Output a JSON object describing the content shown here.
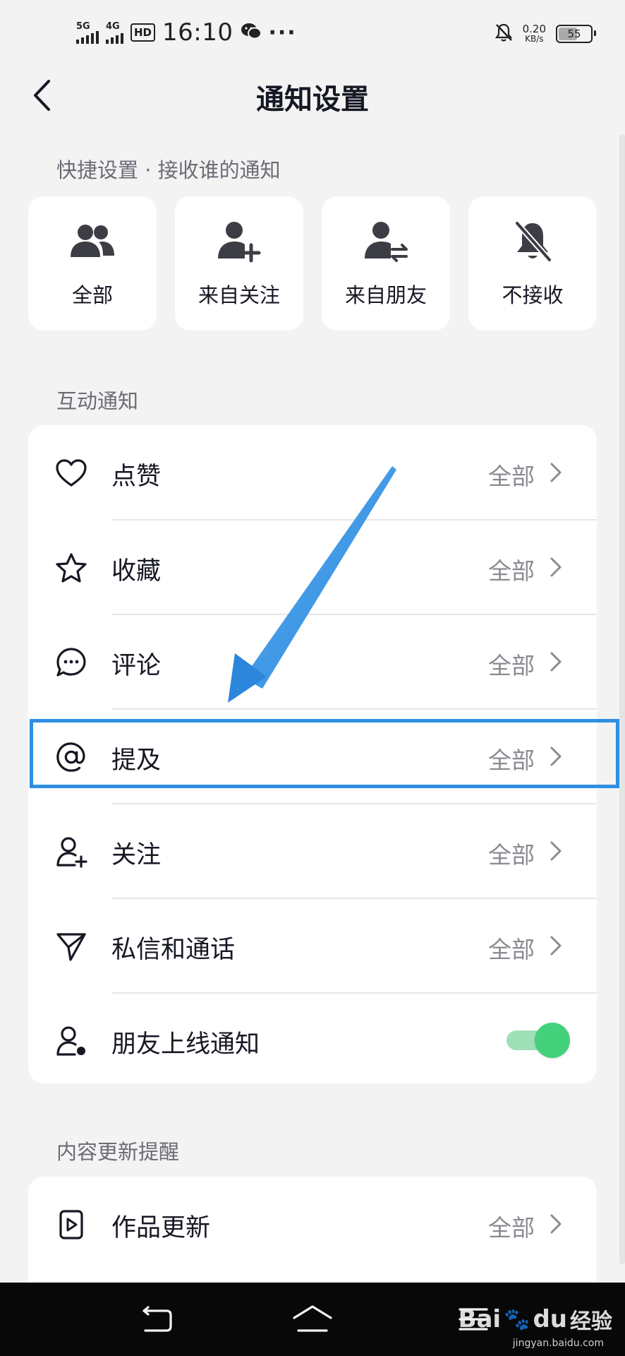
{
  "status_bar": {
    "signal_1": "5G",
    "signal_2": "4G",
    "hd": "HD",
    "time": "16:10",
    "more": "···",
    "net_speed_value": "0.20",
    "net_speed_unit": "KB/s",
    "battery": "55"
  },
  "header": {
    "title": "通知设置",
    "back_icon": "chevron-left-icon"
  },
  "quick_settings": {
    "title": "快捷设置 · 接收谁的通知",
    "options": [
      {
        "label": "全部",
        "icon": "users-icon"
      },
      {
        "label": "来自关注",
        "icon": "user-add-icon"
      },
      {
        "label": "来自朋友",
        "icon": "user-swap-icon"
      },
      {
        "label": "不接收",
        "icon": "bell-off-icon"
      }
    ]
  },
  "interaction_section": {
    "title": "互动通知",
    "rows": [
      {
        "label": "点赞",
        "value": "全部",
        "icon": "heart-icon"
      },
      {
        "label": "收藏",
        "value": "全部",
        "icon": "star-icon"
      },
      {
        "label": "评论",
        "value": "全部",
        "icon": "comment-icon"
      },
      {
        "label": "提及",
        "value": "全部",
        "icon": "at-icon"
      },
      {
        "label": "关注",
        "value": "全部",
        "icon": "user-follow-icon"
      },
      {
        "label": "私信和通话",
        "value": "全部",
        "icon": "send-icon"
      },
      {
        "label": "朋友上线通知",
        "icon": "user-online-icon",
        "toggle_on": true
      }
    ]
  },
  "content_section": {
    "title": "内容更新提醒",
    "rows": [
      {
        "label": "作品更新",
        "value": "全部",
        "icon": "video-icon"
      }
    ]
  },
  "nav_bar": {
    "back_icon": "nav-back-icon",
    "home_icon": "nav-home-icon",
    "menu_icon": "nav-menu-icon"
  },
  "watermark": {
    "brand": "Bai",
    "brand_tail": "du",
    "cn": "经验",
    "url": "jingyan.baidu.com"
  },
  "colors": {
    "background": "#f3f3f3",
    "card": "#ffffff",
    "highlight": "#2f8fe0",
    "toggle_on": "#43d17b"
  }
}
